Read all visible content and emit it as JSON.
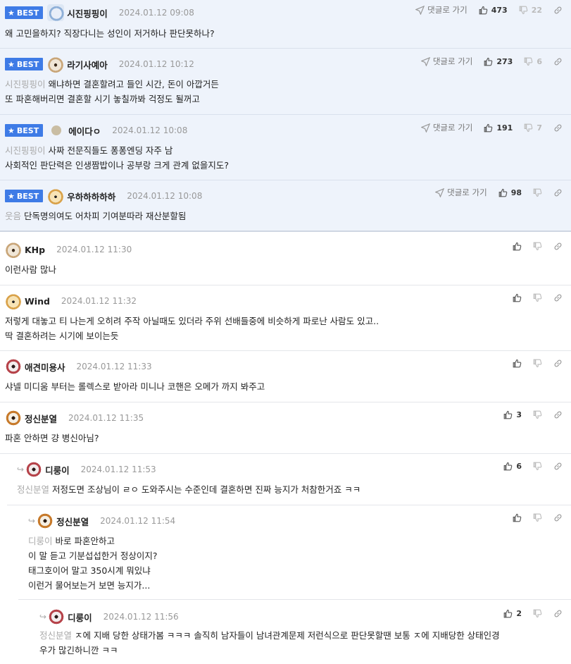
{
  "best_label": "BEST",
  "goto_label": "댓글로 가기",
  "best": [
    {
      "nick": "시진핑핑이",
      "date": "2024.01.12 09:08",
      "up": "473",
      "down": "22",
      "lines": [
        {
          "mention": "",
          "text": "왜 고민을하지? 직장다니는 성인이 저거하나 판단못하나?"
        }
      ]
    },
    {
      "nick": "라기사예아",
      "date": "2024.01.12 10:12",
      "up": "273",
      "down": "6",
      "lines": [
        {
          "mention": "시진핑핑이",
          "text": "왜냐하면 결혼할려고 들인 시간, 돈이 아깝거든"
        },
        {
          "mention": "",
          "text": "또 파혼해버리면 결혼할 시기 놓칠까봐 걱정도 될꺼고"
        }
      ]
    },
    {
      "nick": "에이다ㅇ",
      "date": "2024.01.12 10:08",
      "up": "191",
      "down": "7",
      "lines": [
        {
          "mention": "시진핑핑이",
          "text": "사짜 전문직들도 퐁퐁엔딩 자주 남"
        },
        {
          "mention": "",
          "text": "사회적인 판단력은 인생짬밥이나 공부랑 크게 관계 없을지도?"
        }
      ]
    },
    {
      "nick": "우하하하하하",
      "date": "2024.01.12 10:08",
      "up": "98",
      "down": "",
      "lines": [
        {
          "mention": "웃음",
          "text": "단독명의여도 어차피 기여분따라 재산분할됨"
        }
      ]
    }
  ],
  "comments": [
    {
      "nick": "KHp",
      "date": "2024.01.12 11:30",
      "up": "",
      "lines": [
        {
          "mention": "",
          "text": "이런사람 많나"
        }
      ]
    },
    {
      "nick": "Wind",
      "date": "2024.01.12 11:32",
      "up": "",
      "lines": [
        {
          "mention": "",
          "text": "저렇게 대놓고 티 나는게 오히려 주작 아닐때도 있더라 주위 선배들중에 비슷하게 파로난 사람도 있고.."
        },
        {
          "mention": "",
          "text": "딱 결혼하려는 시기에 보이는듯"
        }
      ]
    },
    {
      "nick": "애견미용사",
      "date": "2024.01.12 11:33",
      "up": "",
      "lines": [
        {
          "mention": "",
          "text": "샤넬 미디움 부터는 롤렉스로 받아라 미니나 코핸은 오메가 까지 봐주고"
        }
      ]
    },
    {
      "nick": "정신분열",
      "date": "2024.01.12 11:35",
      "up": "3",
      "lines": [
        {
          "mention": "",
          "text": "파혼 안하면 걍 병신아님?"
        }
      ]
    },
    {
      "nick": "디룽이",
      "date": "2024.01.12 11:53",
      "up": "6",
      "lines": [
        {
          "mention": "정신분열",
          "text": "저정도면 조상님이 ㄹㅇ 도와주시는 수준인데 결혼하면 진짜 능지가 처참한거죠 ㅋㅋ"
        }
      ]
    },
    {
      "nick": "정신분열",
      "date": "2024.01.12 11:54",
      "up": "",
      "lines": [
        {
          "mention": "디룽이",
          "text": "바로 파혼안하고"
        },
        {
          "mention": "",
          "text": "이 말 듣고 기분섭섭한거 정상이지?"
        },
        {
          "mention": "",
          "text": "태그호이어 말고 350시계 뭐있냐"
        },
        {
          "mention": "",
          "text": "이런거 물어보는거 보면 능지가..."
        }
      ]
    },
    {
      "nick": "디룽이",
      "date": "2024.01.12 11:56",
      "up": "2",
      "lines": [
        {
          "mention": "정신분열",
          "text": "ㅈ에 지배 당한 상태가봄 ㅋㅋㅋ 솔직히 남자들이 남녀관계문제 저런식으로 판단못할땐 보통 ㅈ에 지배당한 상태인경"
        },
        {
          "mention": "",
          "text": "우가 많긴하니깐 ㅋㅋ"
        }
      ]
    }
  ],
  "icons": {
    "best_star": "star-icon",
    "thumb_up": "thumb-up-icon",
    "thumb_down": "thumb-down-icon",
    "link": "link-icon",
    "goto": "send-arrow-icon",
    "reply": "reply-arrow-icon"
  },
  "colors": {
    "best_badge": "#3e7be6",
    "best_bg": "#eef3fb",
    "mention": "#aaaaaa",
    "date": "#999999"
  }
}
